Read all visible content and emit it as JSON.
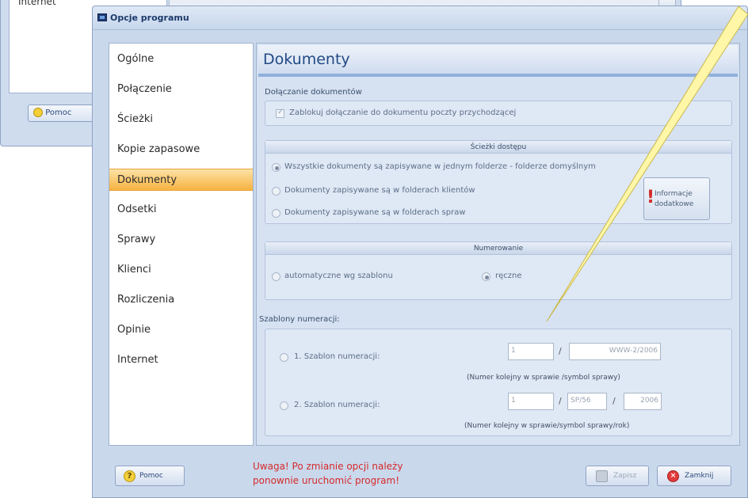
{
  "background_window": {
    "list_item": "Internet",
    "help_label": "Pomoc"
  },
  "dialog": {
    "title": "Opcje programu",
    "close_glyph": "x"
  },
  "nav": {
    "items": [
      {
        "label": "Ogólne"
      },
      {
        "label": "Połączenie"
      },
      {
        "label": "Ścieżki"
      },
      {
        "label": "Kopie zapasowe"
      },
      {
        "label": "Dokumenty"
      },
      {
        "label": "Odsetki"
      },
      {
        "label": "Sprawy"
      },
      {
        "label": "Klienci"
      },
      {
        "label": "Rozliczenia"
      },
      {
        "label": "Opinie"
      },
      {
        "label": "Internet"
      }
    ],
    "active_index": 4
  },
  "panel": {
    "title": "Dokumenty",
    "attach_section": "Dołączanie dokumentów",
    "attach_checkbox": "Zablokuj dołączanie do dokumentu poczty przychodzącej",
    "paths": {
      "header": "Ścieżki dostępu",
      "options": [
        "Wszystkie dokumenty są zapisywane w jednym folderze - folderze domyślnym",
        "Dokumenty zapisywane są w folderach klientów",
        "Dokumenty zapisywane są w folderach spraw"
      ],
      "selected_index": 0,
      "info_button_line1": "Informacje",
      "info_button_line2": "dodatkowe"
    },
    "numbering": {
      "header": "Numerowanie",
      "auto_label": "automatyczne wg szablonu",
      "manual_label": "ręczne",
      "selected": "manual"
    },
    "templates": {
      "section_label": "Szablony numeracji:",
      "template1": {
        "label": "1. Szablon numeracji:",
        "field1": "1",
        "field2": "WWW-2/2006",
        "note": "(Numer kolejny w sprawie /symbol sprawy)"
      },
      "template2": {
        "label": "2. Szablon numeracji:",
        "field1": "1",
        "field2": "SP/56",
        "field3": "2006",
        "note": "(Numer kolejny w sprawie/symbol sprawy/rok)"
      },
      "separator": "/"
    }
  },
  "footer": {
    "help_label": "Pomoc",
    "warning_line1": "Uwaga! Po zmianie opcji należy",
    "warning_line2": "ponownie uruchomić program!",
    "save_label": "Zapisz",
    "close_label": "Zamknij"
  },
  "colors": {
    "accent_active": "#f7b340",
    "title_blue": "#234a86",
    "warning_red": "#d42a2a",
    "callout_yellow": "#fff6a8"
  }
}
